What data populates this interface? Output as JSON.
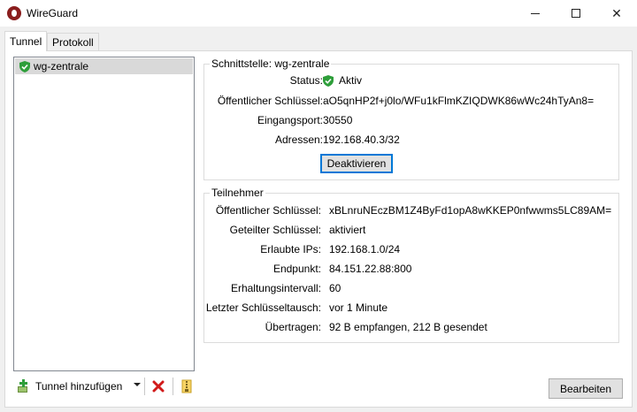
{
  "window": {
    "title": "WireGuard"
  },
  "tabs": [
    {
      "label": "Tunnel",
      "active": true
    },
    {
      "label": "Protokoll",
      "active": false
    }
  ],
  "tunnels": [
    {
      "name": "wg-zentrale",
      "status_icon": "shield-check-icon",
      "selected": true
    }
  ],
  "toolbar": {
    "add_label": "Tunnel hinzufügen",
    "add_icon": "plus-icon",
    "delete_icon": "red-x-icon",
    "export_icon": "zip-icon"
  },
  "interface": {
    "heading": "Schnittstelle: wg-zentrale",
    "status_label": "Status:",
    "status_value": "Aktiv",
    "pubkey_label": "Öffentlicher Schlüssel:",
    "pubkey_value": "aO5qnHP2f+j0lo/WFu1kFlmKZIQDWK86wWc24hTyAn8=",
    "port_label": "Eingangsport:",
    "port_value": "30550",
    "addr_label": "Adressen:",
    "addr_value": "192.168.40.3/32",
    "deactivate_label": "Deaktivieren"
  },
  "peer": {
    "heading": "Teilnehmer",
    "pubkey_label": "Öffentlicher Schlüssel:",
    "pubkey_value": "xBLnruNEczBM1Z4ByFd1opA8wKKEP0nfwwms5LC89AM=",
    "psk_label": "Geteilter Schlüssel:",
    "psk_value": "aktiviert",
    "allowed_label": "Erlaubte IPs:",
    "allowed_value": "192.168.1.0/24",
    "endpoint_label": "Endpunkt:",
    "endpoint_value": "84.151.22.88:800",
    "keepalive_label": "Erhaltungsintervall:",
    "keepalive_value": "60",
    "handshake_label": "Letzter Schlüsseltausch:",
    "handshake_value": "vor 1 Minute",
    "transfer_label": "Übertragen:",
    "transfer_value": "92 B empfangen, 212 B gesendet"
  },
  "actions": {
    "edit_label": "Bearbeiten"
  },
  "colors": {
    "active_green": "#2e9e3a",
    "delete_red": "#d11a1a",
    "focus_blue": "#0078d7"
  }
}
